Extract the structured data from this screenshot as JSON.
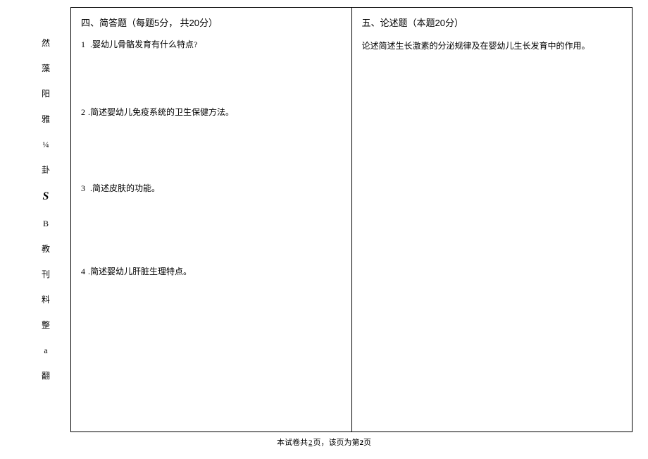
{
  "sidebar": {
    "chars": [
      "然",
      "藻",
      "阳",
      "雅",
      "¼",
      "卦",
      "S",
      "B",
      "教",
      "刊",
      "料",
      "整",
      "a",
      "翻"
    ]
  },
  "left": {
    "section_title_prefix": "四、简答题（每题",
    "section_title_points_per": "5",
    "section_title_mid": "分， 共",
    "section_title_total": "20",
    "section_title_suffix": "分）",
    "q1_num": "1",
    "q1_text": " .婴幼儿骨骼发育有什么特点?",
    "q2_num": "2",
    "q2_text": ".简述婴幼儿免疫系统的卫生保健方法。",
    "q3_num": "3",
    "q3_text": " .简述皮肤的功能。",
    "q4_num": "4",
    "q4_text": ".简述婴幼儿肝脏生理特点。"
  },
  "right": {
    "section_title_prefix": "五、论述题（本题",
    "section_title_points": "20",
    "section_title_suffix": "分）",
    "prompt": "论述简述生长激素的分泌规律及在婴幼儿生长发育中的作用。"
  },
  "footer": {
    "prefix": "本试卷共",
    "total_pages": "2",
    "mid": "页，该页为第",
    "current_page": "2",
    "suffix": "页"
  }
}
